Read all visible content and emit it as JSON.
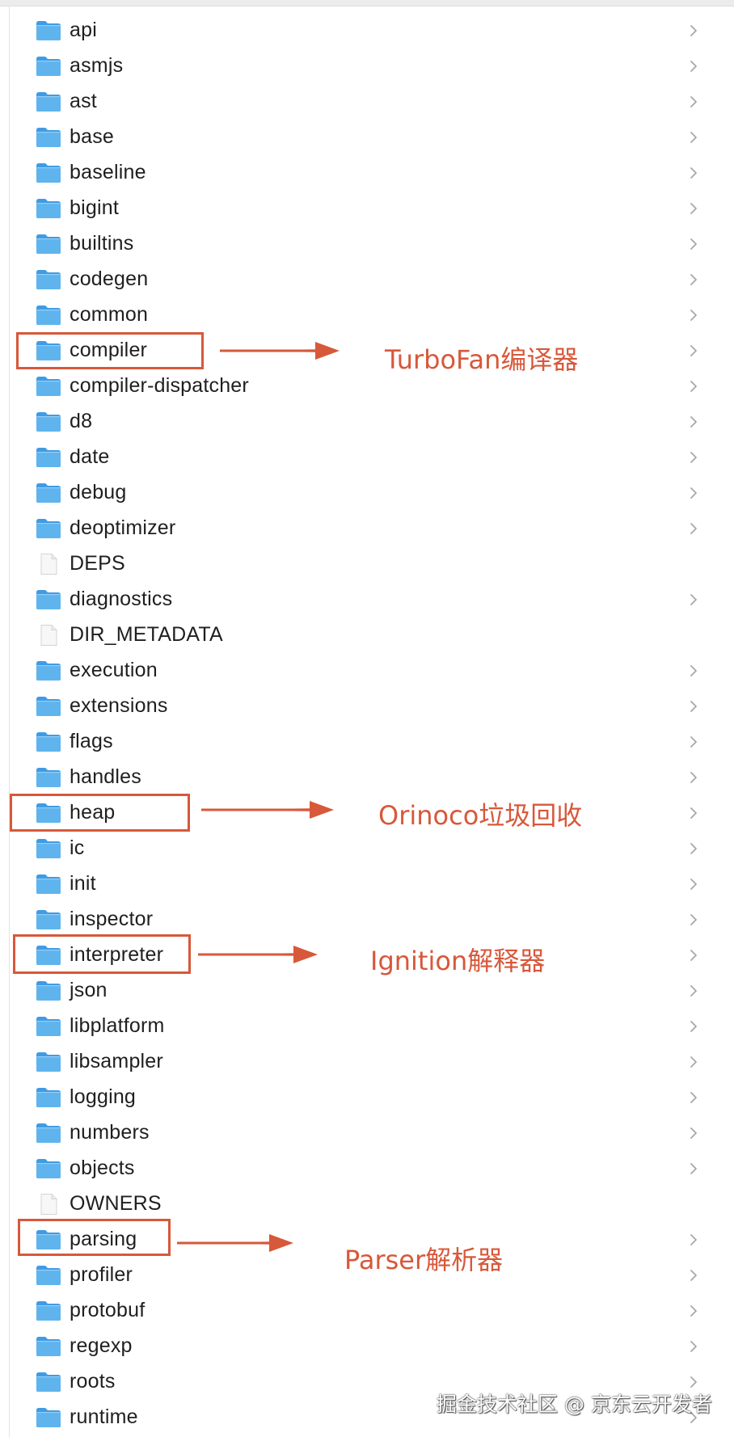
{
  "entries": [
    {
      "name": "api",
      "type": "folder"
    },
    {
      "name": "asmjs",
      "type": "folder"
    },
    {
      "name": "ast",
      "type": "folder"
    },
    {
      "name": "base",
      "type": "folder"
    },
    {
      "name": "baseline",
      "type": "folder"
    },
    {
      "name": "bigint",
      "type": "folder"
    },
    {
      "name": "builtins",
      "type": "folder"
    },
    {
      "name": "codegen",
      "type": "folder"
    },
    {
      "name": "common",
      "type": "folder"
    },
    {
      "name": "compiler",
      "type": "folder"
    },
    {
      "name": "compiler-dispatcher",
      "type": "folder"
    },
    {
      "name": "d8",
      "type": "folder"
    },
    {
      "name": "date",
      "type": "folder"
    },
    {
      "name": "debug",
      "type": "folder"
    },
    {
      "name": "deoptimizer",
      "type": "folder"
    },
    {
      "name": "DEPS",
      "type": "file"
    },
    {
      "name": "diagnostics",
      "type": "folder"
    },
    {
      "name": "DIR_METADATA",
      "type": "file"
    },
    {
      "name": "execution",
      "type": "folder"
    },
    {
      "name": "extensions",
      "type": "folder"
    },
    {
      "name": "flags",
      "type": "folder"
    },
    {
      "name": "handles",
      "type": "folder"
    },
    {
      "name": "heap",
      "type": "folder"
    },
    {
      "name": "ic",
      "type": "folder"
    },
    {
      "name": "init",
      "type": "folder"
    },
    {
      "name": "inspector",
      "type": "folder"
    },
    {
      "name": "interpreter",
      "type": "folder"
    },
    {
      "name": "json",
      "type": "folder"
    },
    {
      "name": "libplatform",
      "type": "folder"
    },
    {
      "name": "libsampler",
      "type": "folder"
    },
    {
      "name": "logging",
      "type": "folder"
    },
    {
      "name": "numbers",
      "type": "folder"
    },
    {
      "name": "objects",
      "type": "folder"
    },
    {
      "name": "OWNERS",
      "type": "file"
    },
    {
      "name": "parsing",
      "type": "folder"
    },
    {
      "name": "profiler",
      "type": "folder"
    },
    {
      "name": "protobuf",
      "type": "folder"
    },
    {
      "name": "regexp",
      "type": "folder"
    },
    {
      "name": "roots",
      "type": "folder"
    },
    {
      "name": "runtime",
      "type": "folder"
    }
  ],
  "annotations": [
    {
      "target": "compiler",
      "text": "TurboFan编译器"
    },
    {
      "target": "heap",
      "text": "Orinoco垃圾回收"
    },
    {
      "target": "interpreter",
      "text": "Ignition解释器"
    },
    {
      "target": "parsing",
      "text": "Parser解析器"
    }
  ],
  "watermark": "掘金技术社区 @ 京东云开发者",
  "colors": {
    "annotation": "#d7583a",
    "folder_front": "#5fb4ee",
    "folder_back": "#3f9ce4",
    "chevron": "#a8a8a8"
  },
  "icons": {
    "folder": "folder-icon",
    "file": "document-icon",
    "chevron": "chevron-right-icon"
  }
}
